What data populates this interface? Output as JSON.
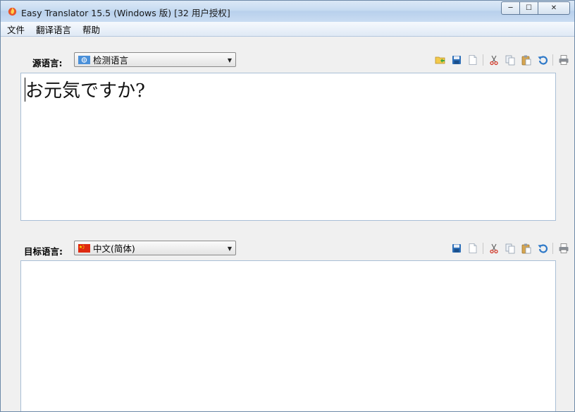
{
  "window": {
    "title": "Easy Translator 15.5 (Windows 版) [32 用户授权]",
    "controls": {
      "minimize": "─",
      "maximize": "☐",
      "close": "✕"
    }
  },
  "menu": {
    "items": [
      "文件",
      "翻译语言",
      "帮助"
    ]
  },
  "source": {
    "label": "源语言:",
    "selected_language": "检测语言",
    "flag": "un-flag-icon",
    "text": "お元気ですか?"
  },
  "target": {
    "label": "目标语言:",
    "selected_language": "中文(简体)",
    "flag": "china-flag-icon",
    "text": ""
  },
  "source_toolbar": [
    "open-icon",
    "save-icon",
    "new-icon",
    "cut-icon",
    "copy-icon",
    "paste-icon",
    "undo-icon",
    "print-icon"
  ],
  "target_toolbar": [
    "save-icon",
    "new-icon",
    "cut-icon",
    "copy-icon",
    "paste-icon",
    "undo-icon",
    "print-icon"
  ],
  "colors": {
    "accent": "#3a7ec5",
    "border": "#a9bfd6",
    "flag_red": "#de2910"
  }
}
